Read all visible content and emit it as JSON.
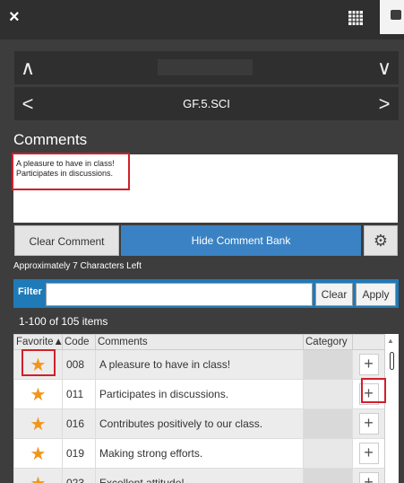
{
  "window": {
    "close_glyph": "×"
  },
  "nav": {
    "up_glyph": "∧",
    "down_glyph": "∨",
    "prev_glyph": "<",
    "next_glyph": ">",
    "page_heading": "GF.5.SCI"
  },
  "comments": {
    "label": "Comments",
    "lines": [
      "A pleasure to have in class!",
      "Participates in discussions."
    ],
    "chars_left": "Approximately 7 Characters Left"
  },
  "buttons": {
    "clear_comment": "Clear Comment",
    "hide_bank": "Hide Comment Bank",
    "gear_glyph": "⚙"
  },
  "filter": {
    "label": "Filter",
    "value": "",
    "clear": "Clear",
    "apply": "Apply"
  },
  "grid": {
    "count": "1-100 of 105 items",
    "headers": {
      "favorite": "Favorite▲",
      "code": "Code",
      "comments": "Comments",
      "category": "Category"
    },
    "rows": [
      {
        "code": "008",
        "comment": "A pleasure to have in class!",
        "category": ""
      },
      {
        "code": "011",
        "comment": "Participates in discussions.",
        "category": ""
      },
      {
        "code": "016",
        "comment": "Contributes positively to our class.",
        "category": ""
      },
      {
        "code": "019",
        "comment": "Making strong efforts.",
        "category": ""
      },
      {
        "code": "023",
        "comment": "Excellent attitude!",
        "category": ""
      }
    ],
    "star_glyph": "★",
    "plus_glyph": "+"
  },
  "colors": {
    "highlight": "#d0202a",
    "accent": "#3a82c3",
    "star": "#f0961c"
  }
}
